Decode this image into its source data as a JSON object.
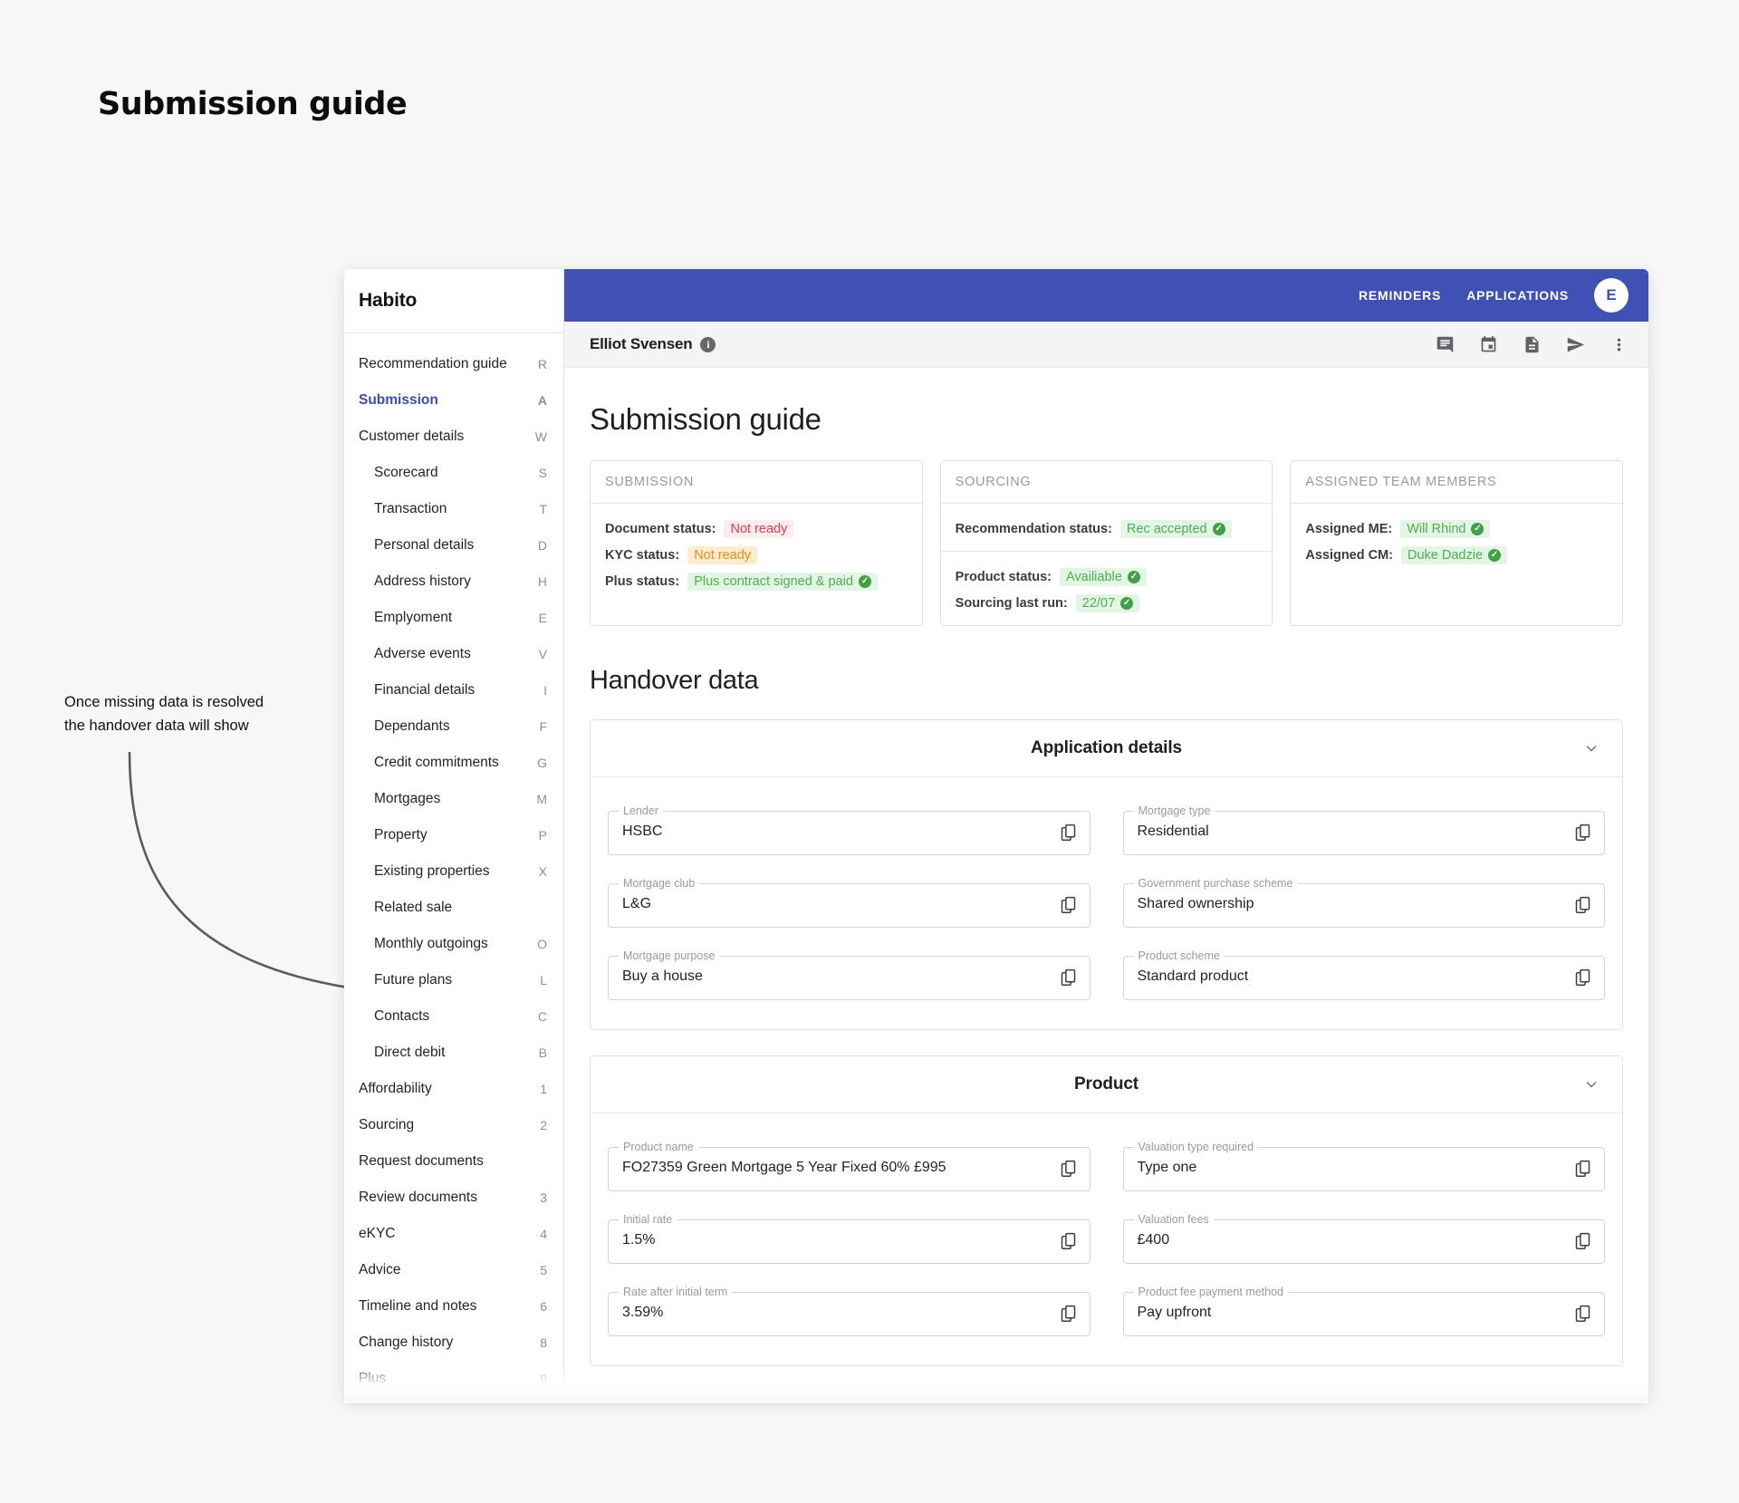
{
  "annotation": {
    "title": "Submission guide",
    "note": "Once missing data is resolved the handover data will show"
  },
  "sidebar": {
    "brand": "Habito",
    "items": [
      {
        "label": "Recommendation guide",
        "key": "R",
        "indent": false,
        "active": false
      },
      {
        "label": "Submission",
        "key": "A",
        "indent": false,
        "active": true
      },
      {
        "label": "Customer details",
        "key": "W",
        "indent": false,
        "active": false
      },
      {
        "label": "Scorecard",
        "key": "S",
        "indent": true,
        "active": false
      },
      {
        "label": "Transaction",
        "key": "T",
        "indent": true,
        "active": false
      },
      {
        "label": "Personal details",
        "key": "D",
        "indent": true,
        "active": false
      },
      {
        "label": "Address history",
        "key": "H",
        "indent": true,
        "active": false
      },
      {
        "label": "Emplyoment",
        "key": "E",
        "indent": true,
        "active": false
      },
      {
        "label": "Adverse events",
        "key": "V",
        "indent": true,
        "active": false
      },
      {
        "label": "Financial details",
        "key": "I",
        "indent": true,
        "active": false
      },
      {
        "label": "Dependants",
        "key": "F",
        "indent": true,
        "active": false
      },
      {
        "label": "Credit commitments",
        "key": "G",
        "indent": true,
        "active": false
      },
      {
        "label": "Mortgages",
        "key": "M",
        "indent": true,
        "active": false
      },
      {
        "label": "Property",
        "key": "P",
        "indent": true,
        "active": false
      },
      {
        "label": "Existing properties",
        "key": "X",
        "indent": true,
        "active": false
      },
      {
        "label": "Related sale",
        "key": "",
        "indent": true,
        "active": false
      },
      {
        "label": "Monthly outgoings",
        "key": "O",
        "indent": true,
        "active": false
      },
      {
        "label": "Future plans",
        "key": "L",
        "indent": true,
        "active": false
      },
      {
        "label": "Contacts",
        "key": "C",
        "indent": true,
        "active": false
      },
      {
        "label": "Direct debit",
        "key": "B",
        "indent": true,
        "active": false
      },
      {
        "label": "Affordability",
        "key": "1",
        "indent": false,
        "active": false
      },
      {
        "label": "Sourcing",
        "key": "2",
        "indent": false,
        "active": false
      },
      {
        "label": "Request documents",
        "key": "",
        "indent": false,
        "active": false
      },
      {
        "label": "Review documents",
        "key": "3",
        "indent": false,
        "active": false
      },
      {
        "label": "eKYC",
        "key": "4",
        "indent": false,
        "active": false
      },
      {
        "label": "Advice",
        "key": "5",
        "indent": false,
        "active": false
      },
      {
        "label": "Timeline and notes",
        "key": "6",
        "indent": false,
        "active": false
      },
      {
        "label": "Change history",
        "key": "8",
        "indent": false,
        "active": false
      },
      {
        "label": "Plus",
        "key": "9",
        "indent": false,
        "active": false
      }
    ]
  },
  "appbar": {
    "reminders": "REMINDERS",
    "applications": "APPLICATIONS",
    "avatar_initial": "E",
    "brand_color": "#3f51b5"
  },
  "subbar": {
    "customer_name": "Elliot Svensen",
    "info_glyph": "i",
    "icons": [
      "comment-icon",
      "calendar-icon",
      "document-icon",
      "send-icon",
      "more-vert-icon"
    ]
  },
  "page": {
    "heading": "Submission guide",
    "section_heading": "Handover data"
  },
  "status_cards": [
    {
      "title": "SUBMISSION",
      "groups": [
        {
          "divided": false,
          "rows": [
            {
              "label": "Document status:",
              "value": "Not ready",
              "tone": "red",
              "check": false
            },
            {
              "label": "KYC status:",
              "value": "Not ready",
              "tone": "amber",
              "check": false
            },
            {
              "label": "Plus status:",
              "value": "Plus contract signed & paid",
              "tone": "green",
              "check": true
            }
          ]
        }
      ]
    },
    {
      "title": "SOURCING",
      "groups": [
        {
          "divided": true,
          "rows": [
            {
              "label": "Recommendation status:",
              "value": "Rec accepted",
              "tone": "green",
              "check": true
            }
          ]
        },
        {
          "divided": false,
          "rows": [
            {
              "label": "Product status:",
              "value": "Availiable",
              "tone": "green",
              "check": true
            },
            {
              "label": "Sourcing last run:",
              "value": "22/07",
              "tone": "green",
              "check": true
            }
          ]
        }
      ]
    },
    {
      "title": "ASSIGNED TEAM MEMBERS",
      "groups": [
        {
          "divided": false,
          "rows": [
            {
              "label": "Assigned ME:",
              "value": "Will Rhind",
              "tone": "green",
              "check": true
            },
            {
              "label": "Assigned CM:",
              "value": "Duke Dadzie",
              "tone": "green",
              "check": true
            }
          ]
        }
      ]
    }
  ],
  "panels": [
    {
      "title": "Application details",
      "fields": [
        {
          "label": "Lender",
          "value": "HSBC"
        },
        {
          "label": "Mortgage type",
          "value": "Residential"
        },
        {
          "label": "Mortgage club",
          "value": "L&G"
        },
        {
          "label": "Government purchase scheme",
          "value": "Shared ownership"
        },
        {
          "label": "Mortgage purpose",
          "value": "Buy a house"
        },
        {
          "label": "Product scheme",
          "value": "Standard product"
        }
      ]
    },
    {
      "title": "Product",
      "fields": [
        {
          "label": "Product name",
          "value": "FO27359 Green Mortgage 5 Year Fixed 60% £995"
        },
        {
          "label": "Valuation type required",
          "value": "Type one"
        },
        {
          "label": "Initial rate",
          "value": "1.5%"
        },
        {
          "label": "Valuation fees",
          "value": "£400"
        },
        {
          "label": "Rate after initial term",
          "value": "3.59%"
        },
        {
          "label": "Product fee payment method",
          "value": "Pay upfront"
        }
      ]
    }
  ]
}
